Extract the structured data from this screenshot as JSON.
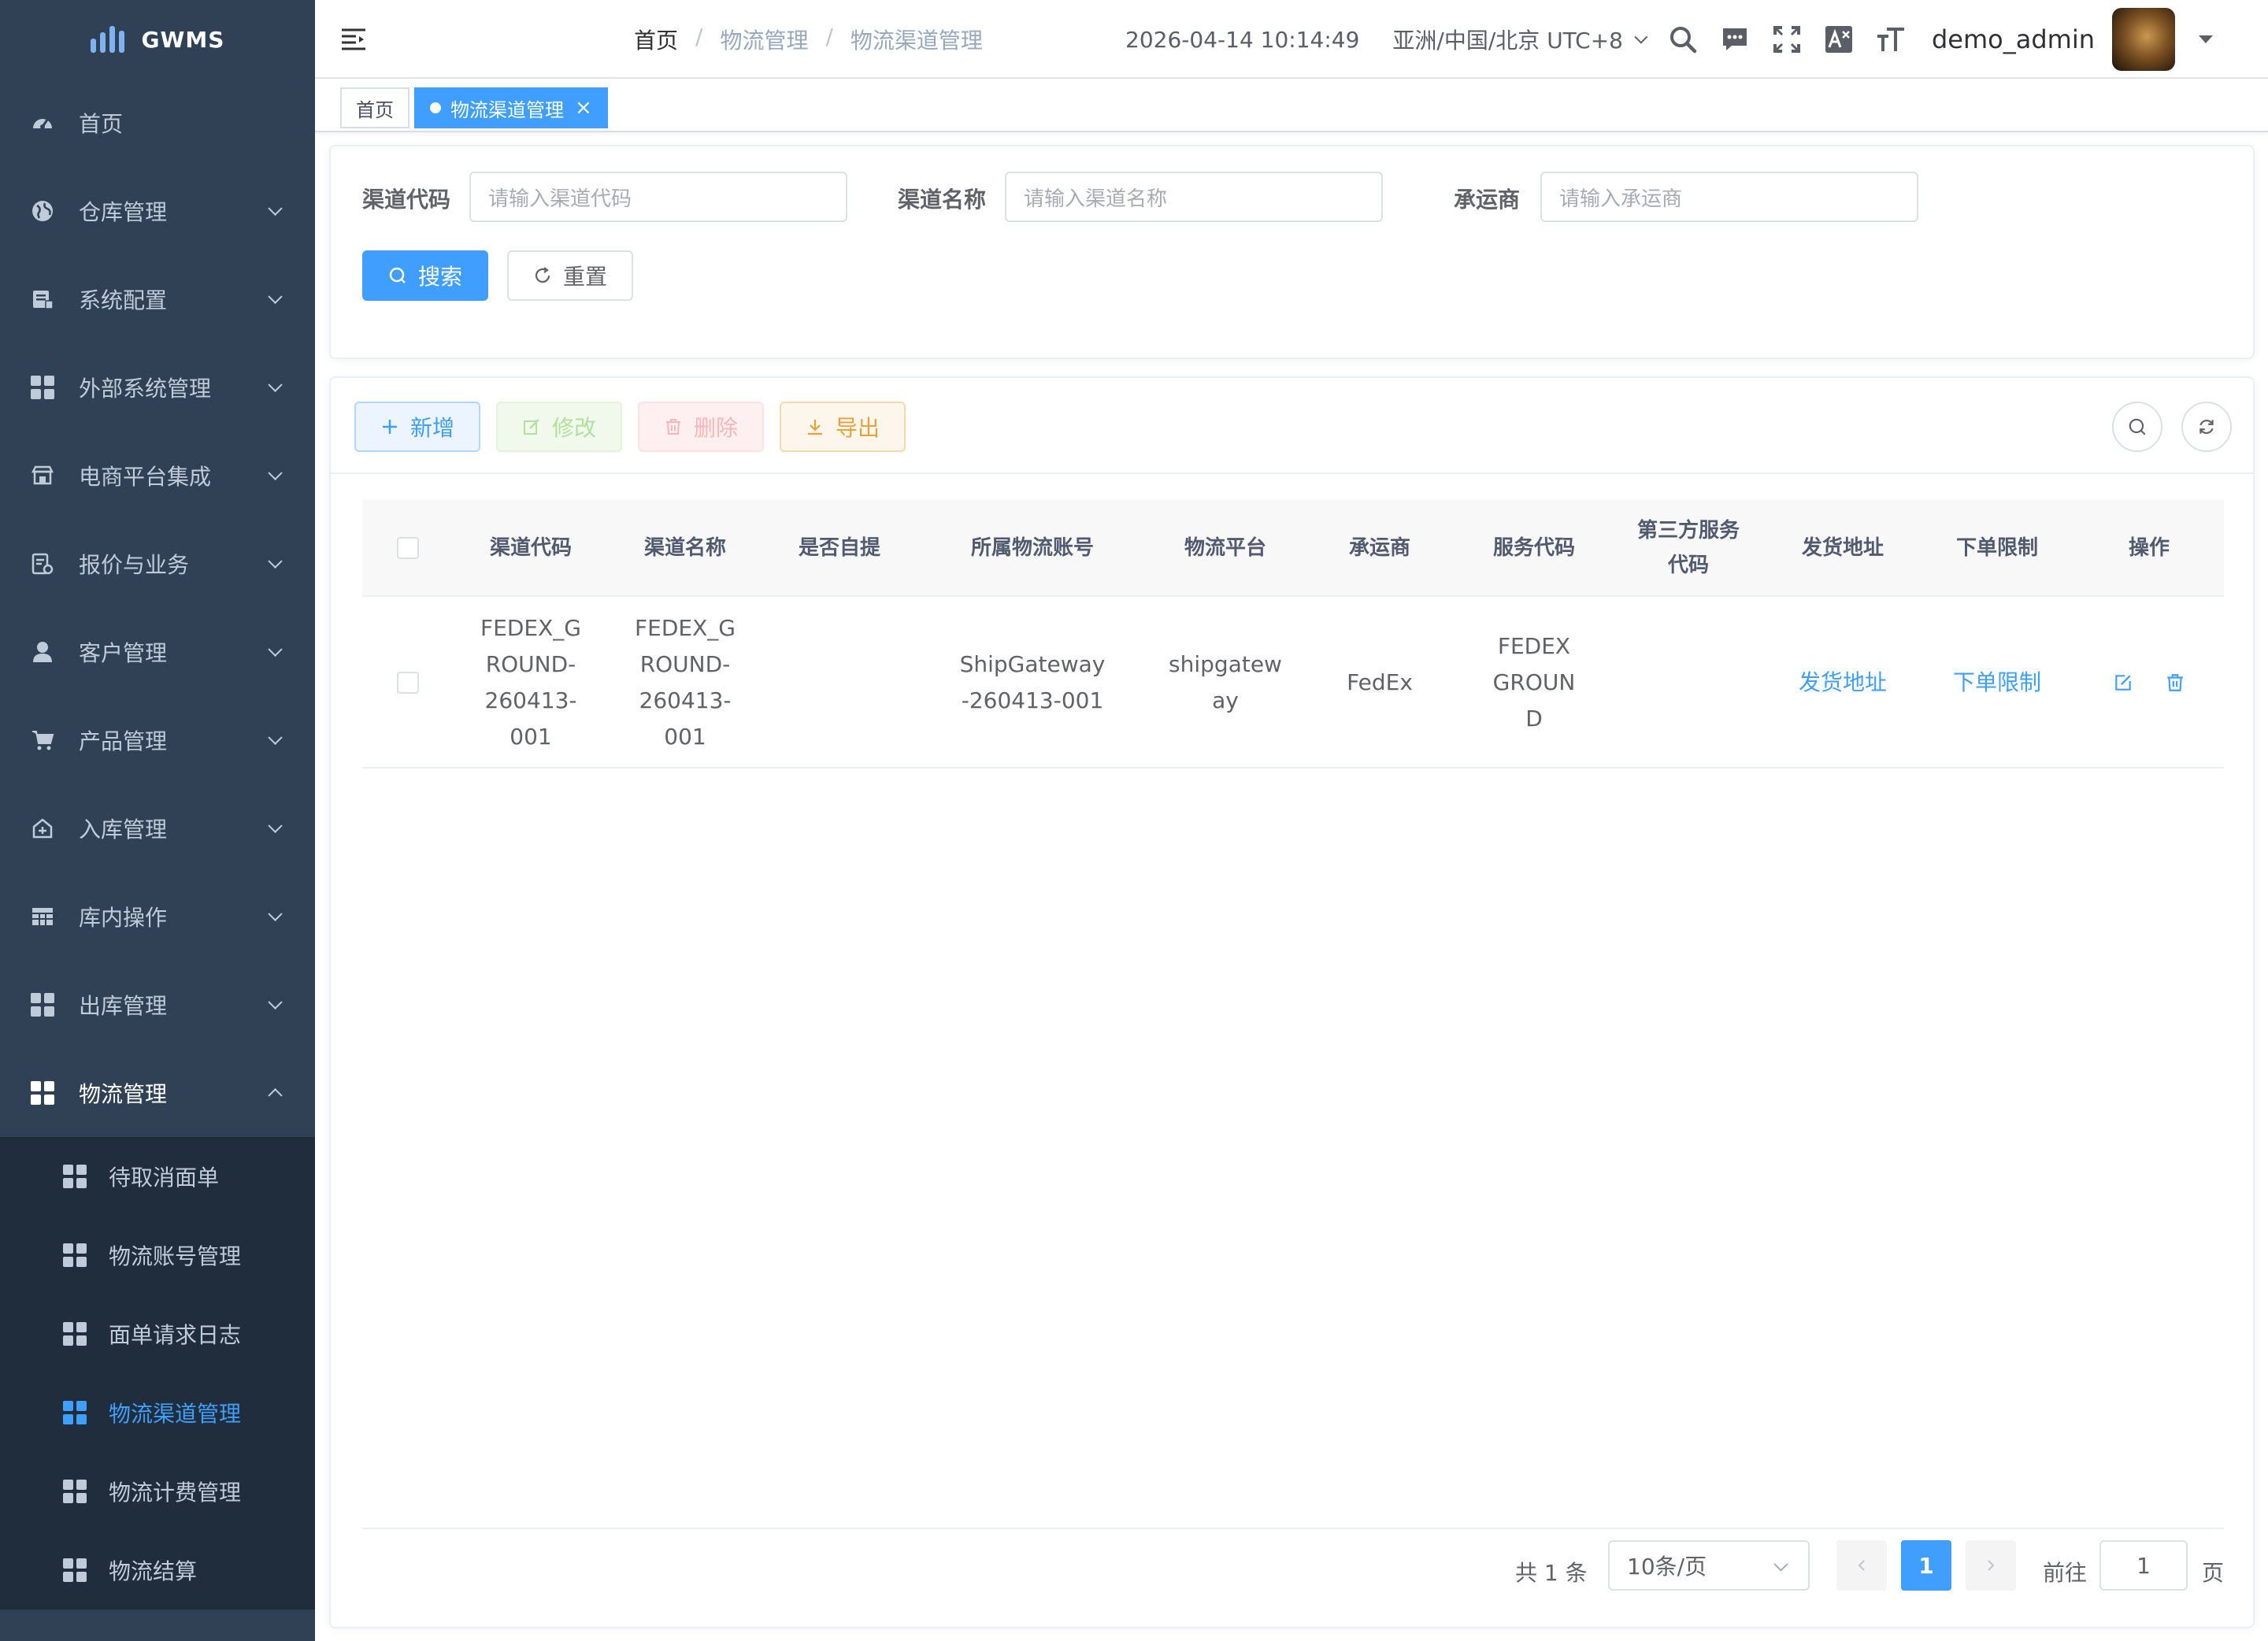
{
  "app": {
    "name": "GWMS"
  },
  "sidebar": {
    "items": [
      {
        "label": "首页",
        "icon": "dashboard-icon"
      },
      {
        "label": "仓库管理",
        "icon": "globe-icon"
      },
      {
        "label": "系统配置",
        "icon": "system-icon"
      },
      {
        "label": "外部系统管理",
        "icon": "component-icon"
      },
      {
        "label": "电商平台集成",
        "icon": "shop-icon"
      },
      {
        "label": "报价与业务",
        "icon": "quote-icon"
      },
      {
        "label": "客户管理",
        "icon": "user-icon"
      },
      {
        "label": "产品管理",
        "icon": "cart-icon"
      },
      {
        "label": "入库管理",
        "icon": "inbound-icon"
      },
      {
        "label": "库内操作",
        "icon": "table-icon"
      },
      {
        "label": "出库管理",
        "icon": "component-icon"
      },
      {
        "label": "物流管理",
        "icon": "component-icon"
      }
    ],
    "subitems": [
      {
        "label": "待取消面单"
      },
      {
        "label": "物流账号管理"
      },
      {
        "label": "面单请求日志"
      },
      {
        "label": "物流渠道管理"
      },
      {
        "label": "物流计费管理"
      },
      {
        "label": "物流结算"
      }
    ],
    "active_sub": "物流渠道管理"
  },
  "header": {
    "breadcrumb": {
      "home": "首页",
      "parent": "物流管理",
      "current": "物流渠道管理",
      "separator": "/"
    },
    "datetime": "2026-04-14 10:14:49",
    "timezone": "亚洲/中国/北京 UTC+8",
    "username": "demo_admin"
  },
  "tags": {
    "home": "首页",
    "active": "物流渠道管理",
    "close": "×"
  },
  "search": {
    "code_label": "渠道代码",
    "code_placeholder": "请输入渠道代码",
    "name_label": "渠道名称",
    "name_placeholder": "请输入渠道名称",
    "carrier_label": "承运商",
    "carrier_placeholder": "请输入承运商",
    "search_btn": "搜索",
    "reset_btn": "重置"
  },
  "toolbar": {
    "add": "新增",
    "edit": "修改",
    "delete": "删除",
    "export": "导出"
  },
  "table": {
    "columns": [
      "渠道代码",
      "渠道名称",
      "是否自提",
      "所属物流账号",
      "物流平台",
      "承运商",
      "服务代码",
      "第三方服务代码",
      "发货地址",
      "下单限制",
      "操作"
    ],
    "rows": [
      {
        "code": "FEDEX_GROUND-260413-001",
        "name": "FEDEX_GROUND-260413-001",
        "self_pickup": "",
        "account": "ShipGateway-260413-001",
        "platform": "shipgateway",
        "carrier": "FedEx",
        "service_code": "FEDEX GROUND",
        "third_party_code": "",
        "address_link": "发货地址",
        "limit_link": "下单限制"
      }
    ]
  },
  "pagination": {
    "total": "共 1 条",
    "page_size": "10条/页",
    "current": "1",
    "goto_label": "前往",
    "goto_value": "1",
    "page_suffix": "页"
  },
  "colors": {
    "sidebar": "#304156",
    "submenu": "#1f2d3d",
    "primary": "#409eff"
  }
}
